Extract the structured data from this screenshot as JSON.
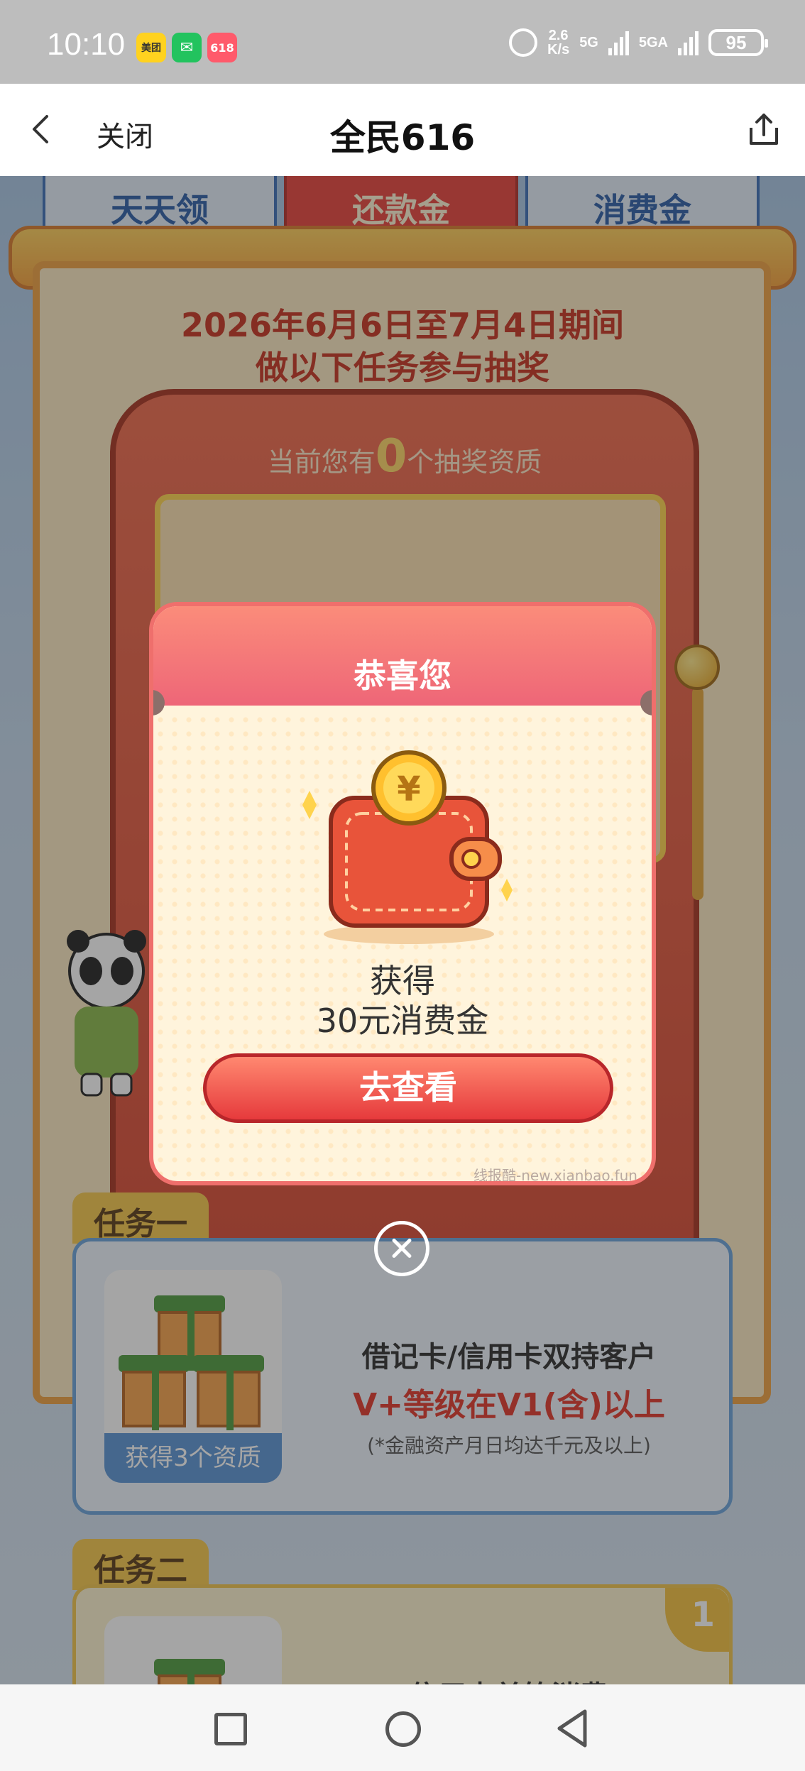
{
  "status_bar": {
    "time": "10:10",
    "app_badges": [
      "美团",
      "✉",
      "618"
    ],
    "net_speed_value": "2.6",
    "net_speed_unit": "K/s",
    "network_1": "5G",
    "network_2": "5GA",
    "battery": "95"
  },
  "nav": {
    "close_label": "关闭",
    "title": "全民616"
  },
  "background": {
    "tabs": [
      "天天领",
      "还款金",
      "消费金"
    ],
    "event_line1": "2026年6月6日至7月4日期间",
    "event_line2": "做以下任务参与抽奖",
    "qualification_prefix": "当前您有",
    "qualification_count": "0",
    "qualification_suffix": "个抽奖资质",
    "tasks": [
      {
        "tag": "任务一",
        "reward": "获得3个资质",
        "line1": "借记卡/信用卡双持客户",
        "line2": "V+等级在V1(含)以上",
        "line3": "(*金融资产月日均达千元及以上)"
      },
      {
        "tag": "任务二",
        "badge": "1",
        "line1": "信用卡单笔消费"
      }
    ]
  },
  "modal": {
    "title": "恭喜您",
    "prize_line1": "获得",
    "prize_line2": "30元消费金",
    "button_label": "去查看",
    "watermark": "线报酷-new.xianbao.fun",
    "coin_symbol": "¥"
  },
  "colors": {
    "accent_red": "#e63a3c",
    "modal_header": "#ee6678",
    "task_blue": "#5b95d6"
  }
}
